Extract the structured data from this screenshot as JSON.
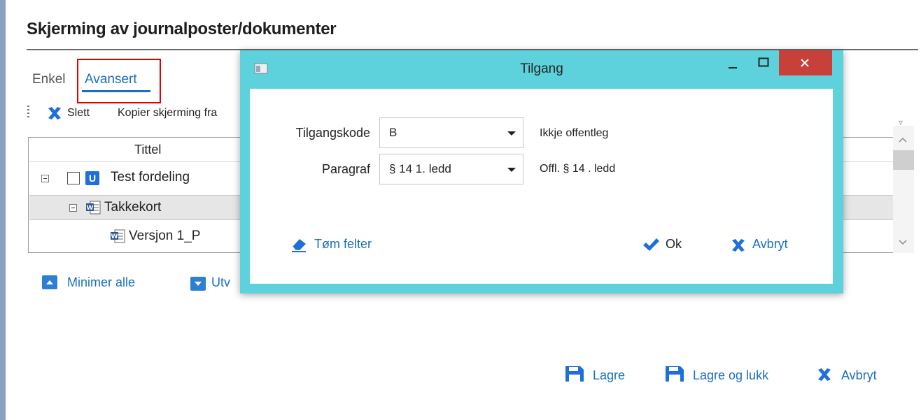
{
  "page": {
    "title": "Skjerming av journalposter/dokumenter"
  },
  "tabs": [
    {
      "label": "Enkel"
    },
    {
      "label": "Avansert"
    }
  ],
  "toolbar": {
    "delete_label": "Slett",
    "copy_label": "Kopier skjerming fra"
  },
  "grid": {
    "column_header": "Tittel",
    "rows": [
      {
        "label": "Test fordeling",
        "icon": "u-icon"
      },
      {
        "label": "Takkekort",
        "icon": "word-document-icon"
      },
      {
        "label": "Versjon 1_P",
        "icon": "word-document-icon"
      }
    ]
  },
  "bottom_links": {
    "collapse_all": "Minimer alle",
    "expand_all": "Utv"
  },
  "footer": {
    "save": "Lagre",
    "save_close": "Lagre og lukk",
    "cancel": "Avbryt"
  },
  "dialog": {
    "title": "Tilgang",
    "fields": [
      {
        "label": "Tilgangskode",
        "value": "B",
        "description": "Ikkje offentleg"
      },
      {
        "label": "Paragraf",
        "value": "§ 14 1. ledd",
        "description": "Offl. § 14 . ledd"
      }
    ],
    "clear_label": "Tøm felter",
    "ok_label": "Ok",
    "cancel_label": "Avbryt"
  },
  "colors": {
    "accent": "#1a6fbf",
    "dialog_frame": "#5dd2dd",
    "close_button": "#c8403a",
    "highlight": "#e00000"
  }
}
